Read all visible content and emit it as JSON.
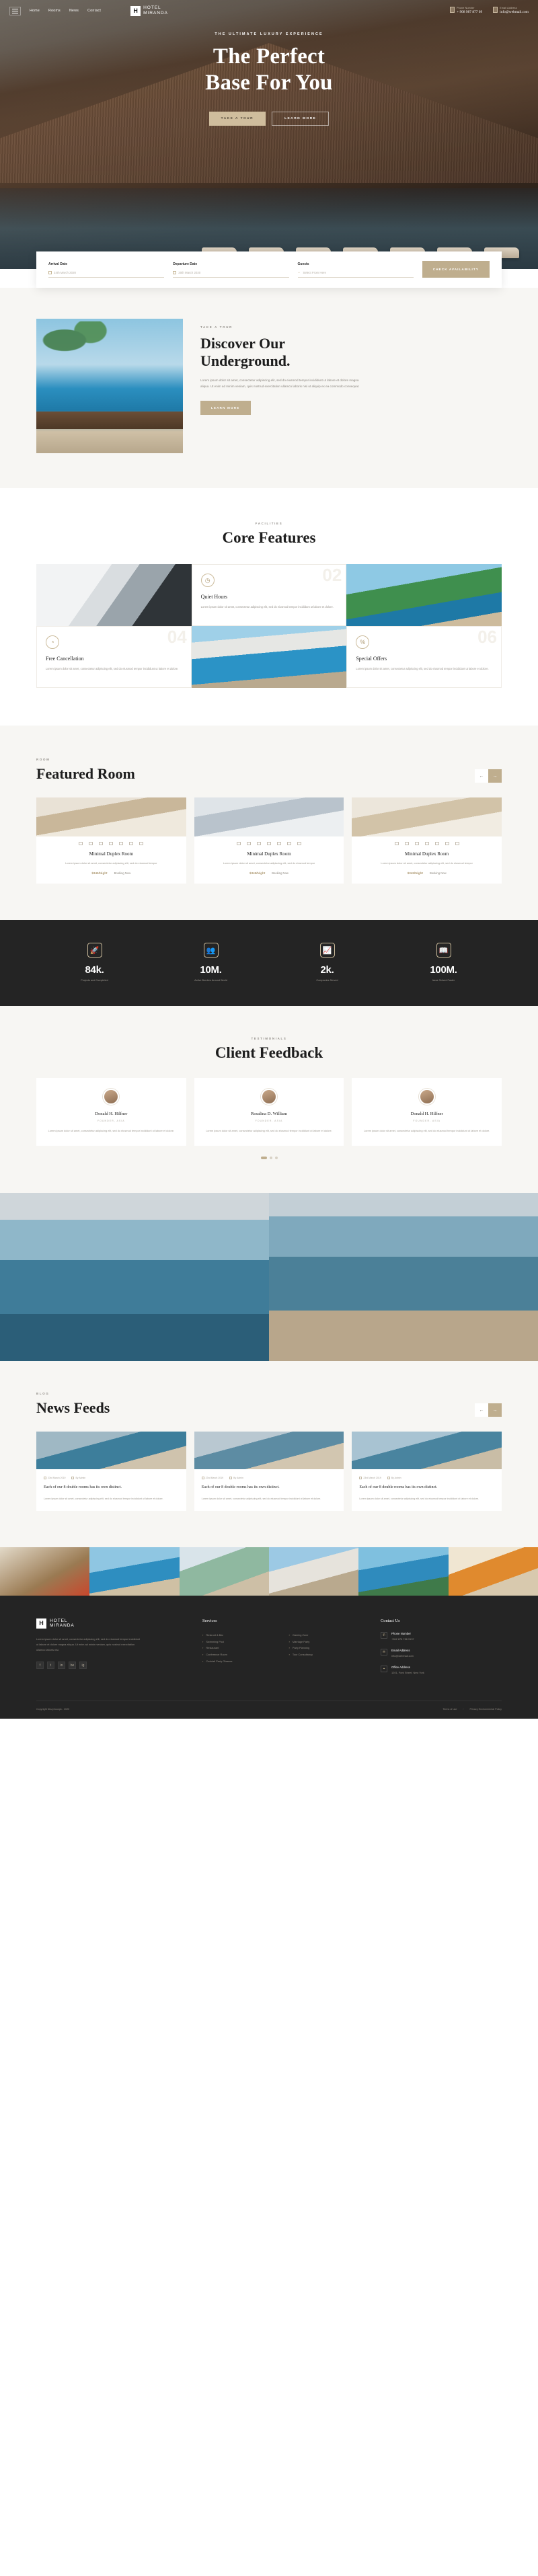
{
  "header": {
    "menu_icon": "hamburger-icon",
    "nav": [
      {
        "label": "Home"
      },
      {
        "label": "Rooms"
      },
      {
        "label": "News"
      },
      {
        "label": "Contact"
      }
    ],
    "brand": {
      "mark": "H",
      "line1": "HOTEL",
      "line2": "MIRANDA"
    },
    "phone": {
      "icon": "phone-icon",
      "label": "Phone Number",
      "value": "+ 908 987 877 09"
    },
    "email": {
      "icon": "mail-icon",
      "label": "Email Address",
      "value": "info@webmail.com"
    }
  },
  "hero": {
    "tagline": "THE ULTIMATE LUXURY EXPERIENCE",
    "title_line1": "The Perfect",
    "title_line2": "Base For You",
    "primary_btn": "TAKE A TOUR",
    "secondary_btn": "LEARN MORE"
  },
  "booking": {
    "arrival": {
      "label": "Arrival Date",
      "value": "24th March 2020",
      "icon": "calendar-icon"
    },
    "departure": {
      "label": "Departure Date",
      "value": "30th March 2020",
      "icon": "calendar-icon"
    },
    "guests": {
      "label": "Guests",
      "value": "Select From Here",
      "icon": "chevron-down-icon"
    },
    "submit": "CHECK AVAILABILITY"
  },
  "discover": {
    "eyebrow": "TAKE A TOUR",
    "title_line1": "Discover Our",
    "title_line2": "Underground.",
    "body": "Lorem ipsum dolor sit amet, consectetur adipiscing elit, sed do eiusmod tempor incididunt ut labore et dolore magna aliqua. Ut enim ad minim veniam, quis nostrud exercitation ullamco laboris nisi ut aliquip ex ea commodo consequat.",
    "button": "LEARN MORE"
  },
  "core": {
    "eyebrow": "FACILITIES",
    "title": "Core Features",
    "cards": [
      {
        "kind": "image",
        "image": "staircase-photo",
        "number": "",
        "icon": "",
        "title": "",
        "desc": ""
      },
      {
        "kind": "text",
        "number": "02",
        "icon": "clock-icon",
        "title": "Quiet Hours",
        "desc": "Lorem ipsum dolor sit amet, consectetur adipiscing elit, sed do eiusmod tempor incididunt ut labore et dolore."
      },
      {
        "kind": "image",
        "image": "palm-resort-photo",
        "number": "",
        "icon": "",
        "title": "",
        "desc": ""
      },
      {
        "kind": "text",
        "number": "04",
        "icon": "clock-cancel-icon",
        "title": "Free Cancellation",
        "desc": "Lorem ipsum dolor sit amet, consectetur adipiscing elit, sed do eiusmod tempor incididunt ut labore et dolore."
      },
      {
        "kind": "image",
        "image": "pool-resort-photo",
        "number": "",
        "icon": "",
        "title": "",
        "desc": ""
      },
      {
        "kind": "text",
        "number": "06",
        "icon": "discount-badge-icon",
        "title": "Special Offers",
        "desc": "Lorem ipsum dolor sit amet, consectetur adipiscing elit, sed do eiusmod tempor incididunt ut labore et dolore."
      }
    ]
  },
  "rooms": {
    "eyebrow": "ROOM",
    "title": "Featured Room",
    "prev_icon": "arrow-left-icon",
    "next_icon": "arrow-right-icon",
    "items": [
      {
        "name": "Minimal Duplex Room",
        "desc": "Lorem ipsum dolor sit amet, consectetur adipiscing elit, sed do eiusmod tempor",
        "price": "$345/Night",
        "cta": "Booking Now",
        "amenities": [
          "bed-icon",
          "wifi-icon",
          "tv-icon",
          "desk-icon",
          "shower-icon",
          "ac-icon",
          "pool-icon"
        ]
      },
      {
        "name": "Minimal Duplex Room",
        "desc": "Lorem ipsum dolor sit amet, consectetur adipiscing elit, sed do eiusmod tempor",
        "price": "$345/Night",
        "cta": "Booking Now",
        "amenities": [
          "bed-icon",
          "wifi-icon",
          "tv-icon",
          "desk-icon",
          "shower-icon",
          "ac-icon",
          "pool-icon"
        ]
      },
      {
        "name": "Minimal Duplex Room",
        "desc": "Lorem ipsum dolor sit amet, consectetur adipiscing elit, sed do eiusmod tempor",
        "price": "$345/Night",
        "cta": "Booking Now",
        "amenities": [
          "bed-icon",
          "wifi-icon",
          "tv-icon",
          "desk-icon",
          "shower-icon",
          "ac-icon",
          "pool-icon"
        ]
      }
    ]
  },
  "counters": [
    {
      "icon": "rocket-icon",
      "number": "84k.",
      "label": "Projects and Completed"
    },
    {
      "icon": "team-icon",
      "number": "10M.",
      "label": "Active Borders Around World"
    },
    {
      "icon": "growth-icon",
      "number": "2k.",
      "label": "Companies Served"
    },
    {
      "icon": "book-icon",
      "number": "100M.",
      "label": "Issue Solved Faster"
    }
  ],
  "testimonials": {
    "eyebrow": "TESTIMONIALS",
    "title": "Client Feedback",
    "items": [
      {
        "avatar": "avatar-image",
        "name": "Donald H. Hilfner",
        "role": "FOUNDER, ASIA",
        "quote": "Lorem ipsum dolor sit amet, consectetur adipiscing elit, sed do eiusmod tempor incididunt ut labore et dolore."
      },
      {
        "avatar": "avatar-image",
        "name": "Rosalina D. William",
        "role": "FOUNDER, ASIA",
        "quote": "Lorem ipsum dolor sit amet, consectetur adipiscing elit, sed do eiusmod tempor incididunt ut labore et dolore."
      },
      {
        "avatar": "avatar-image",
        "name": "Donald H. Hilfner",
        "role": "FOUNDER, ASIA",
        "quote": "Lorem ipsum dolor sit amet, consectetur adipiscing elit, sed do eiusmod tempor incididunt ut labore et dolore."
      }
    ]
  },
  "gallery": [
    {
      "image": "pool-lounge-photo-left"
    },
    {
      "image": "pool-lounge-photo-right"
    }
  ],
  "news": {
    "eyebrow": "BLOG",
    "title": "News Feeds",
    "prev_icon": "arrow-left-icon",
    "next_icon": "arrow-right-icon",
    "items": [
      {
        "image": "spa-interior-photo",
        "date": "23rd March 2019",
        "author": "By Admin",
        "title": "Each of our 8 double rooms has its own distinct.",
        "desc": "Lorem ipsum dolor sit amet, consectetur adipiscing elit, sed do eiusmod tempor incididunt ut labore et dolore."
      },
      {
        "image": "coast-view-photo",
        "date": "23rd March 2019",
        "author": "By Admin",
        "title": "Each of our 8 double rooms has its own distinct.",
        "desc": "Lorem ipsum dolor sit amet, consectetur adipiscing elit, sed do eiusmod tempor incididunt ut labore et dolore."
      },
      {
        "image": "poolside-photo",
        "date": "23rd March 2019",
        "author": "By Admin",
        "title": "Each of our 8 double rooms has its own distinct.",
        "desc": "Lorem ipsum dolor sit amet, consectetur adipiscing elit, sed do eiusmod tempor incididunt ut labore et dolore."
      }
    ]
  },
  "instagram": [
    {
      "image": "tram-street-photo"
    },
    {
      "image": "palm-pool-photo"
    },
    {
      "image": "garden-path-photo"
    },
    {
      "image": "resort-building-photo"
    },
    {
      "image": "palm-sky-photo"
    },
    {
      "image": "cocktail-photo"
    }
  ],
  "footer": {
    "brand": {
      "mark": "H",
      "line1": "HOTEL",
      "line2": "MIRANDA"
    },
    "about": "Lorem ipsum dolor sit amet, consectetur adipiscing elit, sed do eiusmod tempor incididunt ut labore et dolore magna aliqua. Ut enim ad minim veniam, quis nostrud exercitation ullamco laboris nisi.",
    "social": [
      {
        "icon": "facebook-icon",
        "glyph": "f"
      },
      {
        "icon": "twitter-icon",
        "glyph": "t"
      },
      {
        "icon": "linkedin-icon",
        "glyph": "in"
      },
      {
        "icon": "behance-icon",
        "glyph": "be"
      },
      {
        "icon": "instagram-icon",
        "glyph": "ig"
      }
    ],
    "services": {
      "title": "Services",
      "col1": [
        "Restrunt & Bar",
        "Swimming Pool",
        "Restaurant",
        "Conference Room",
        "Cocktail Party Glasses"
      ],
      "col2": [
        "Gaming Zone",
        "Marriage Party",
        "Party Planning",
        "Tour Consultancy"
      ]
    },
    "contact": {
      "title": "Contact Us",
      "items": [
        {
          "icon": "phone-icon",
          "label": "Phone Number",
          "value": "+962 876 786 9137"
        },
        {
          "icon": "mail-icon",
          "label": "Email Address",
          "value": "info@webmail.com"
        },
        {
          "icon": "location-icon",
          "label": "Office Address",
          "value": "1201, Park Street, New York"
        }
      ]
    },
    "copyright": "Copyright Nizzyhouspk - 2020",
    "bottom_links": [
      "Terms of use",
      "Privacy Environmental Policy"
    ]
  }
}
